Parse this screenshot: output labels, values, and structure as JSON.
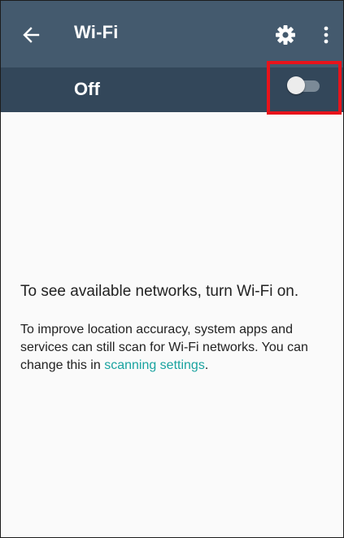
{
  "toolbar": {
    "title": "Wi-Fi",
    "back_icon": "arrow-back-icon",
    "settings_icon": "gear-icon",
    "more_icon": "more-vert-icon",
    "background_color": "#445a6e"
  },
  "switch_bar": {
    "label": "Off",
    "state": "off",
    "background_color": "#33475a",
    "highlight_color": "#e8131b"
  },
  "empty_state": {
    "title": "To see available networks, turn Wi-Fi on.",
    "body_prefix": "To improve location accuracy, system apps and services can still scan for Wi-Fi networks. You can change this in ",
    "link_text": "scanning settings",
    "body_suffix": ".",
    "link_color": "#1aa3a0"
  }
}
